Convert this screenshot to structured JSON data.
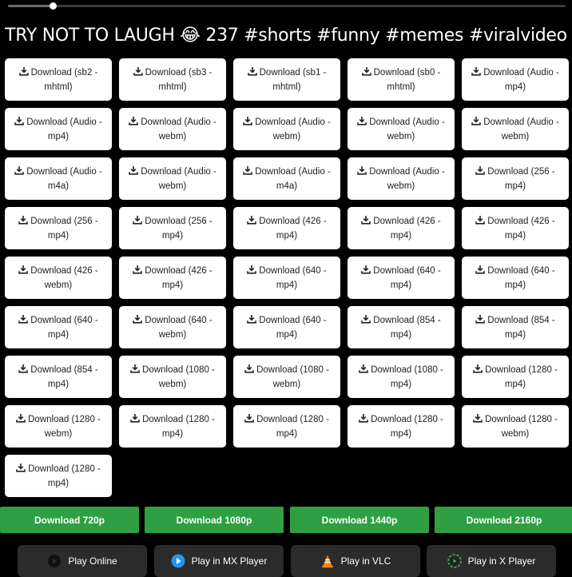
{
  "player": {
    "progress": 0.08
  },
  "title": "TRY NOT TO LAUGH 😂 237 #shorts #funny #memes #viralvideo",
  "download_buttons": [
    "Download (sb2 - mhtml)",
    "Download (sb3 - mhtml)",
    "Download (sb1 - mhtml)",
    "Download (sb0 - mhtml)",
    "Download (Audio - mp4)",
    "Download (Audio - mp4)",
    "Download (Audio - webm)",
    "Download (Audio - webm)",
    "Download (Audio - webm)",
    "Download (Audio - webm)",
    "Download (Audio - m4a)",
    "Download (Audio - webm)",
    "Download (Audio - m4a)",
    "Download (Audio - webm)",
    "Download (256 - mp4)",
    "Download (256 - mp4)",
    "Download (256 - mp4)",
    "Download (426 - mp4)",
    "Download (426 - mp4)",
    "Download (426 - mp4)",
    "Download (426 - webm)",
    "Download (426 - mp4)",
    "Download (640 - mp4)",
    "Download (640 - mp4)",
    "Download (640 - mp4)",
    "Download (640 - mp4)",
    "Download (640 - webm)",
    "Download (640 - mp4)",
    "Download (854 - mp4)",
    "Download (854 - mp4)",
    "Download (854 - mp4)",
    "Download (1080 - webm)",
    "Download (1080 - webm)",
    "Download (1080 - mp4)",
    "Download (1280 - mp4)",
    "Download (1280 - webm)",
    "Download (1280 - mp4)",
    "Download (1280 - mp4)",
    "Download (1280 - mp4)",
    "Download (1280 - webm)",
    "Download (1280 - mp4)"
  ],
  "quick_downloads": [
    "Download 720p",
    "Download 1080p",
    "Download 1440p",
    "Download 2160p"
  ],
  "players": [
    {
      "label": "Play Online",
      "icon": "play-online-icon"
    },
    {
      "label": "Play in MX Player",
      "icon": "mx-player-icon"
    },
    {
      "label": "Play in VLC",
      "icon": "vlc-icon"
    },
    {
      "label": "Play in X Player",
      "icon": "x-player-icon"
    }
  ],
  "colors": {
    "green": "#2ea043",
    "player_bg": "#2b2b2b",
    "card_bg": "#ffffff",
    "page_bg": "#000000"
  }
}
